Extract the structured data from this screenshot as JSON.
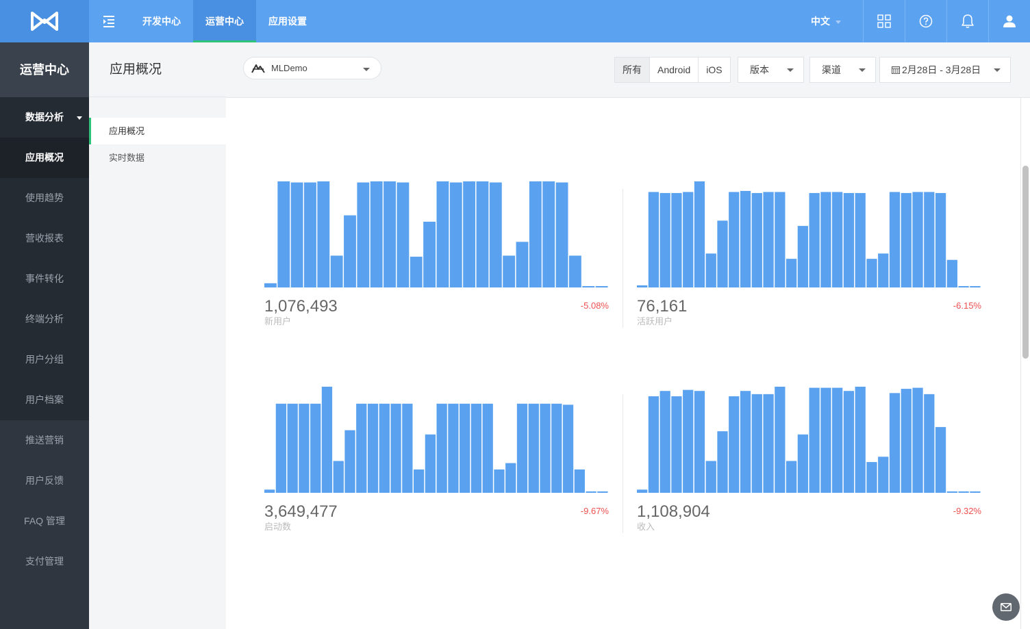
{
  "topnav": {
    "items": [
      "开发中心",
      "运营中心",
      "应用设置"
    ],
    "active": 1,
    "lang": "中文"
  },
  "sidebar": {
    "title": "运营中心",
    "group_head": "数据分析",
    "group_items": [
      "应用概况",
      "使用趋势",
      "营收报表",
      "事件转化",
      "终端分析",
      "用户分组",
      "用户档案"
    ],
    "other_items": [
      "推送营销",
      "用户反馈",
      "FAQ 管理",
      "支付管理"
    ]
  },
  "subnav": {
    "title": "应用概况",
    "items": [
      "应用概况",
      "实时数据"
    ]
  },
  "toolbar": {
    "app_name": "MLDemo",
    "platforms": [
      "所有",
      "Android",
      "iOS"
    ],
    "version_label": "版本",
    "channel_label": "渠道",
    "date_range": "2月28日 - 3月28日"
  },
  "colors": {
    "bar": "#5aa1ef",
    "accent": "#2fc27a",
    "negative": "#f05050"
  },
  "chart_data": [
    {
      "type": "bar",
      "total": "1,076,493",
      "label": "新用户",
      "change": "-5.08%",
      "values": [
        4,
        100,
        99,
        99,
        100,
        30,
        68,
        99,
        100,
        100,
        99,
        29,
        62,
        100,
        99,
        100,
        100,
        99,
        30,
        43,
        100,
        100,
        99,
        30,
        1,
        1
      ]
    },
    {
      "type": "bar",
      "total": "76,161",
      "label": "活跃用户",
      "change": "-6.15%",
      "values": [
        2,
        90,
        89,
        89,
        90,
        100,
        32,
        63,
        90,
        91,
        89,
        90,
        90,
        27,
        58,
        89,
        90,
        90,
        89,
        89,
        27,
        32,
        90,
        89,
        90,
        90,
        89,
        26,
        1,
        1
      ]
    },
    {
      "type": "bar",
      "total": "3,649,477",
      "label": "启动数",
      "change": "-9.67%",
      "values": [
        3,
        84,
        84,
        84,
        84,
        100,
        30,
        59,
        84,
        84,
        84,
        84,
        84,
        22,
        55,
        84,
        84,
        84,
        84,
        84,
        22,
        28,
        84,
        84,
        84,
        84,
        83,
        22,
        1,
        1
      ]
    },
    {
      "type": "bar",
      "total": "1,108,904",
      "label": "收入",
      "change": "-9.32%",
      "values": [
        3,
        91,
        96,
        91,
        97,
        96,
        30,
        58,
        91,
        96,
        93,
        93,
        100,
        30,
        55,
        99,
        99,
        99,
        96,
        100,
        29,
        34,
        94,
        98,
        99,
        93,
        62,
        1,
        1,
        1
      ]
    }
  ]
}
